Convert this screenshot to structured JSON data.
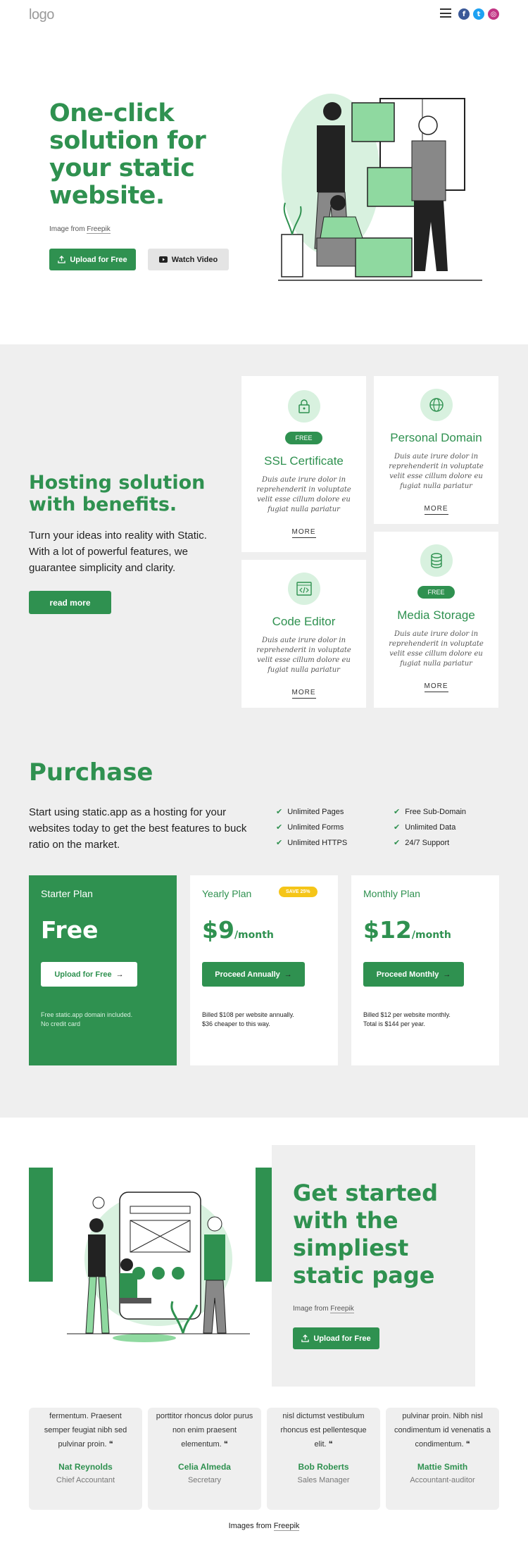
{
  "header": {
    "logo": "logo",
    "social": [
      {
        "name": "facebook",
        "glyph": "f",
        "color": "#3b5998"
      },
      {
        "name": "twitter",
        "glyph": "t",
        "color": "#1da1f2"
      },
      {
        "name": "instagram",
        "glyph": "◎",
        "color": "#c13584"
      }
    ]
  },
  "hero": {
    "title": "One-click solution for your static website.",
    "credit_prefix": "Image from ",
    "credit_link": "Freepik",
    "upload_label": "Upload for Free",
    "video_label": "Watch Video"
  },
  "benefits": {
    "title": "Hosting solution with benefits.",
    "text": "Turn your ideas into reality with Static. With a lot of powerful features, we guarantee simplicity and clarity.",
    "read_more": "read more",
    "cards": [
      {
        "title": "SSL Certificate",
        "badge": "FREE",
        "icon": "lock-icon",
        "text": "Duis aute irure dolor in reprehenderit in voluptate velit esse cillum dolore eu fugiat nulla pariatur",
        "more": "MORE"
      },
      {
        "title": "Personal Domain",
        "badge": "",
        "icon": "globe-icon",
        "text": "Duis aute irure dolor in reprehenderit in voluptate velit esse cillum dolore eu fugiat nulla pariatur",
        "more": "MORE"
      },
      {
        "title": "Code Editor",
        "badge": "",
        "icon": "code-icon",
        "text": "Duis aute irure dolor in reprehenderit in voluptate velit esse cillum dolore eu fugiat nulla pariatur",
        "more": "MORE"
      },
      {
        "title": "Media Storage",
        "badge": "FREE",
        "icon": "database-icon",
        "text": "Duis aute irure dolor in reprehenderit in voluptate velit esse cillum dolore eu fugiat nulla pariatur",
        "more": "MORE"
      }
    ]
  },
  "purchase": {
    "title": "Purchase",
    "text": "Start using static.app as a hosting for your websites today to get the best features to buck ratio on the market.",
    "features_left": [
      "Unlimited Pages",
      "Unlimited Forms",
      "Unlimited HTTPS"
    ],
    "features_right": [
      "Free Sub-Domain",
      "Unlimited Data",
      "24/7 Support"
    ],
    "plans": [
      {
        "name": "Starter Plan",
        "price": "Free",
        "per": "",
        "badge": "",
        "button": "Upload for Free",
        "note1": "Free static.app domain included.",
        "note2": "No credit card"
      },
      {
        "name": "Yearly Plan",
        "price": "$9",
        "per": "/month",
        "badge": "SAVE 25%",
        "button": "Proceed Annually",
        "note1": "Billed $108 per website annually.",
        "note2": "$36 cheaper to this way."
      },
      {
        "name": "Monthly Plan",
        "price": "$12",
        "per": "/month",
        "badge": "",
        "button": "Proceed Monthly",
        "note1": "Billed $12 per website monthly.",
        "note2": "Total is $144 per year."
      }
    ]
  },
  "get_started": {
    "title": "Get started with the simpliest static page",
    "credit_prefix": "Image from ",
    "credit_link": "Freepik",
    "upload_label": "Upload for Free"
  },
  "testimonials": [
    {
      "quote": "fermentum. Praesent semper feugiat nibh sed pulvinar proin. ❝",
      "name": "Nat Reynolds",
      "role": "Chief Accountant"
    },
    {
      "quote": "porttitor rhoncus dolor purus non enim praesent elementum. ❝",
      "name": "Celia Almeda",
      "role": "Secretary"
    },
    {
      "quote": "nisl dictumst vestibulum rhoncus est pellentesque elit. ❝",
      "name": "Bob Roberts",
      "role": "Sales Manager"
    },
    {
      "quote": "pulvinar proin. Nibh nisl condimentum id venenatis a condimentum. ❝",
      "name": "Mattie Smith",
      "role": "Accountant-auditor"
    }
  ],
  "footer": {
    "credit_prefix": "Images from ",
    "credit_link": "Freepik"
  }
}
